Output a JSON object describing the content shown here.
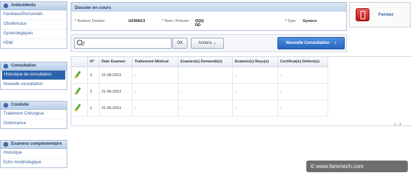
{
  "sidebar": {
    "panels": [
      {
        "title": "Antécédents",
        "items": [
          "Familiaux/Personnels",
          "Obstétricaux",
          "Gynécologiques",
          "HDM"
        ]
      },
      {
        "title": "Consultation",
        "items": [
          "Historique de consultation",
          "Nouvelle consultation"
        ],
        "active": "Historique de consultation"
      },
      {
        "title": "Conduite",
        "items": [
          "Traitement Chirurgical",
          "Ordonnance"
        ]
      },
      {
        "title": "Examens complementaire",
        "items": [
          "Historique",
          "Echo morphologique"
        ]
      }
    ]
  },
  "dossier": {
    "title": "Dossier en cours",
    "fields": [
      {
        "required": "*",
        "label": "Numero Dossier",
        "value": "G0308/13"
      },
      {
        "required": "*",
        "label": "Nom / Prénom",
        "value": "QQQ DD"
      },
      {
        "required": "*",
        "label": "Type",
        "value": "Gyneco"
      }
    ]
  },
  "fermer": {
    "label": "Fermer",
    "icon": "exit-door-icon"
  },
  "toolbar": {
    "search_value": "",
    "ok_label": "OK",
    "actions_label": "Actions",
    "new_label": "Nouvelle Consultation"
  },
  "table": {
    "headers": [
      "",
      "N°",
      "Date Examen",
      "Traitement Médical",
      "Examen(s) Demandé(s)",
      "Examen(s) Reçu(s)",
      "Certificat(s) Délivré(s)"
    ],
    "rows": [
      {
        "n": "3",
        "date": "21-08-2013",
        "traitement": "-",
        "demandes": "-",
        "recus": "-",
        "certificats": "-"
      },
      {
        "n": "2",
        "date": "21-05-2013",
        "traitement": "-",
        "demandes": "-",
        "recus": "-",
        "certificats": "-"
      },
      {
        "n": "1",
        "date": "21-05-2013",
        "traitement": "-",
        "demandes": "-",
        "recus": "-",
        "certificats": "-"
      }
    ],
    "pager": "1 - 3"
  },
  "watermark": "© www.fammech.com",
  "colors": {
    "accent": "#2c63ad",
    "header_bg": "#c3d6ee",
    "button_blue": "#2866bf",
    "required": "#cc0000"
  }
}
